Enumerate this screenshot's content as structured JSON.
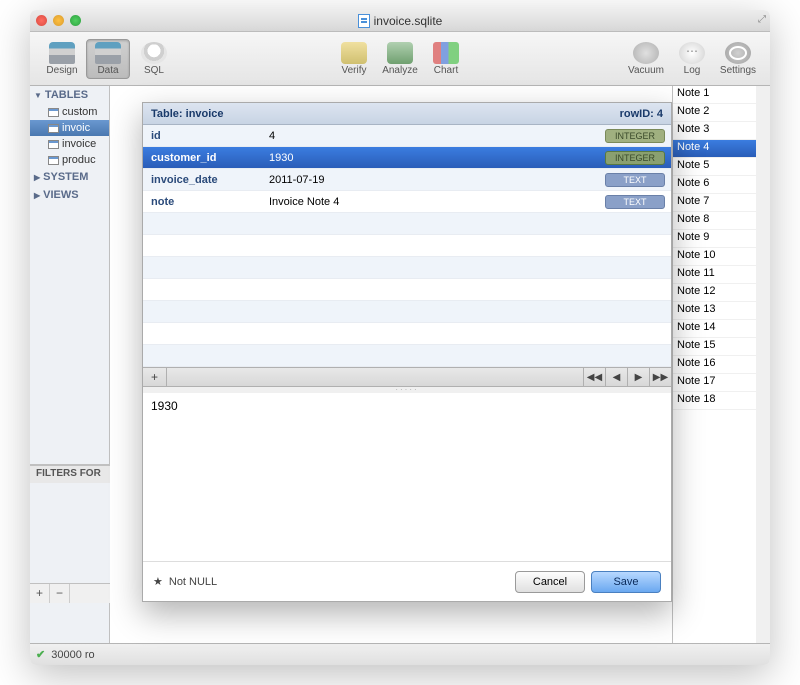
{
  "window": {
    "title": "invoice.sqlite"
  },
  "toolbar": {
    "design": "Design",
    "data": "Data",
    "sql": "SQL",
    "verify": "Verify",
    "analyze": "Analyze",
    "chart": "Chart",
    "vacuum": "Vacuum",
    "log": "Log",
    "settings": "Settings"
  },
  "sidebar": {
    "tables_label": "TABLES",
    "system_label": "SYSTEM",
    "views_label": "VIEWS",
    "tables": [
      "custom",
      "invoic",
      "invoice",
      "produc"
    ],
    "filters_label": "FILTERS FOR",
    "add_btn": "+",
    "remove_btn": "−"
  },
  "notes": [
    "Note 1",
    "Note 2",
    "Note 3",
    "Note 4",
    "Note 5",
    "Note 6",
    "Note 7",
    "Note 8",
    "Note 9",
    "Note 10",
    "Note 11",
    "Note 12",
    "Note 13",
    "Note 14",
    "Note 15",
    "Note 16",
    "Note 17",
    "Note 18"
  ],
  "notes_selected_index": 3,
  "status": {
    "text": "30000 ro"
  },
  "dialog": {
    "title_prefix": "Table: ",
    "table_name": "invoice",
    "row_id_label": "rowID: ",
    "row_id": "4",
    "columns": [
      {
        "name": "id",
        "value": "4",
        "type": "INTEGER"
      },
      {
        "name": "customer_id",
        "value": "1930",
        "type": "INTEGER"
      },
      {
        "name": "invoice_date",
        "value": "2011-07-19",
        "type": "TEXT"
      },
      {
        "name": "note",
        "value": "Invoice Note 4",
        "type": "TEXT"
      }
    ],
    "selected_index": 1,
    "add_btn": "+",
    "nav": {
      "first": "◀◀",
      "prev": "◀",
      "next": "▶",
      "last": "▶▶"
    },
    "editor_value": "1930",
    "not_null_star": "★",
    "not_null_label": "Not NULL",
    "cancel": "Cancel",
    "save": "Save"
  }
}
